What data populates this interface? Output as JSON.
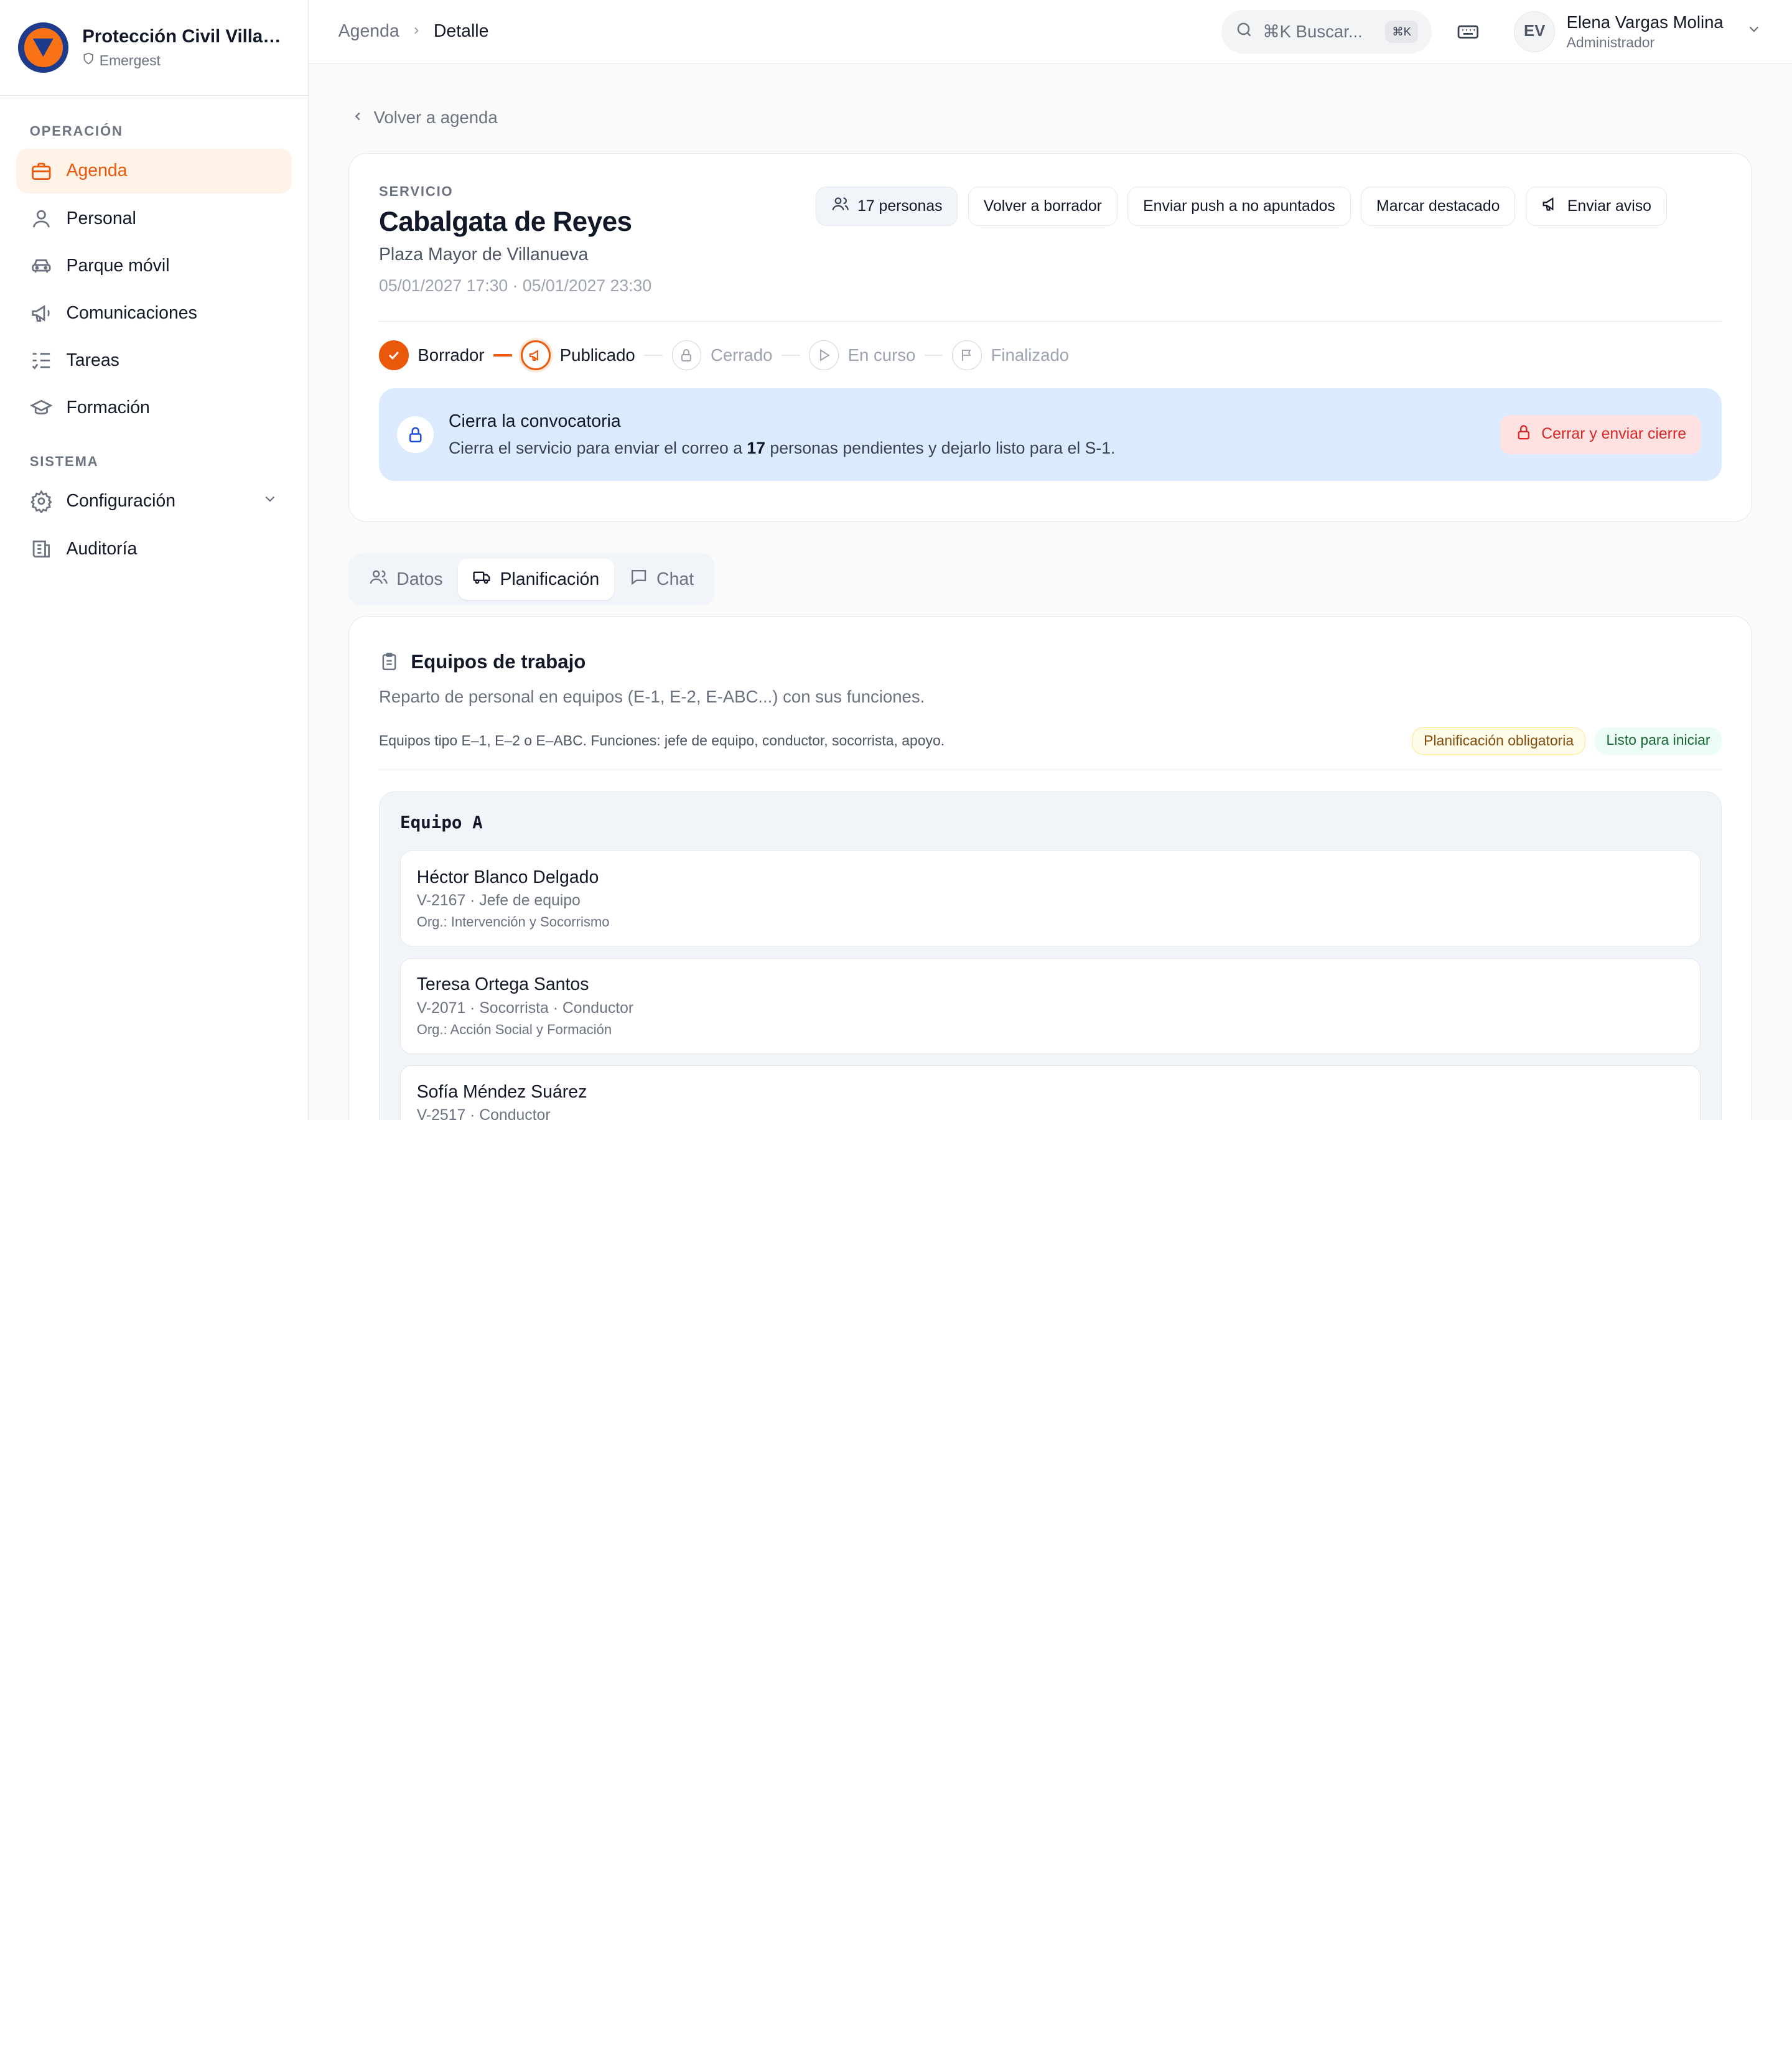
{
  "brand": {
    "title": "Protección Civil Villanueva",
    "subtitle": "Emergest"
  },
  "sidebar": {
    "sections": [
      {
        "heading": "OPERACIÓN"
      },
      {
        "heading": "SISTEMA"
      }
    ],
    "items": [
      {
        "label": "Agenda",
        "icon": "briefcase-icon"
      },
      {
        "label": "Personal",
        "icon": "user-icon"
      },
      {
        "label": "Parque móvil",
        "icon": "car-icon"
      },
      {
        "label": "Comunicaciones",
        "icon": "megaphone-icon"
      },
      {
        "label": "Tareas",
        "icon": "tasks-icon"
      },
      {
        "label": "Formación",
        "icon": "graduation-cap-icon"
      },
      {
        "label": "Configuración",
        "icon": "gear-icon"
      },
      {
        "label": "Auditoría",
        "icon": "ledger-icon"
      }
    ]
  },
  "topbar": {
    "breadcrumb": [
      "Agenda",
      "Detalle"
    ],
    "search_placeholder": "⌘K Buscar...",
    "search_shortcut": "⌘K",
    "user": {
      "initials": "EV",
      "name": "Elena Vargas Molina",
      "role": "Administrador"
    }
  },
  "back_label": "Volver a agenda",
  "service": {
    "label": "SERVICIO",
    "title": "Cabalgata de Reyes",
    "place": "Plaza Mayor de Villanueva",
    "dates": "05/01/2027 17:30 · 05/01/2027 23:30",
    "actions": {
      "people": "17 personas",
      "to_draft": "Volver a borrador",
      "push": "Enviar push a no apuntados",
      "feature": "Marcar destacado",
      "notice": "Enviar aviso"
    },
    "steps": [
      {
        "label": "Borrador",
        "state": "done"
      },
      {
        "label": "Publicado",
        "state": "current"
      },
      {
        "label": "Cerrado",
        "state": "pending"
      },
      {
        "label": "En curso",
        "state": "pending"
      },
      {
        "label": "Finalizado",
        "state": "pending"
      }
    ],
    "alert": {
      "title": "Cierra la convocatoria",
      "desc_before": "Cierra el servicio para enviar el correo a ",
      "desc_count": "17",
      "desc_after": " personas pendientes y dejarlo listo para el S-1.",
      "button": "Cerrar y enviar cierre"
    }
  },
  "tabs": [
    {
      "label": "Datos",
      "icon": "users-icon"
    },
    {
      "label": "Planificación",
      "icon": "truck-icon"
    },
    {
      "label": "Chat",
      "icon": "chat-icon"
    }
  ],
  "planning": {
    "title": "Equipos de trabajo",
    "description": "Reparto de personal en equipos (E-1, E-2, E-ABC...) con sus funciones.",
    "note": "Equipos tipo E–1, E–2 o E–ABC. Funciones: jefe de equipo, conductor, socorrista, apoyo.",
    "badge_required": "Planificación obligatoria",
    "badge_ready": "Listo para iniciar",
    "team": {
      "name": "Equipo A",
      "members": [
        {
          "name": "Héctor Blanco Delgado",
          "role": "V-2167 · Jefe de equipo",
          "org": "Org.: Intervención y Socorrismo"
        },
        {
          "name": "Teresa Ortega Santos",
          "role": "V-2071 · Socorrista · Conductor",
          "org": "Org.: Acción Social y Formación"
        },
        {
          "name": "Sofía Méndez Suárez",
          "role": "V-2517 · Conductor",
          "org": ""
        }
      ]
    }
  },
  "colors": {
    "accent": "#ea580c",
    "alert_bg": "#dbeafe",
    "danger": "#dc2626"
  }
}
